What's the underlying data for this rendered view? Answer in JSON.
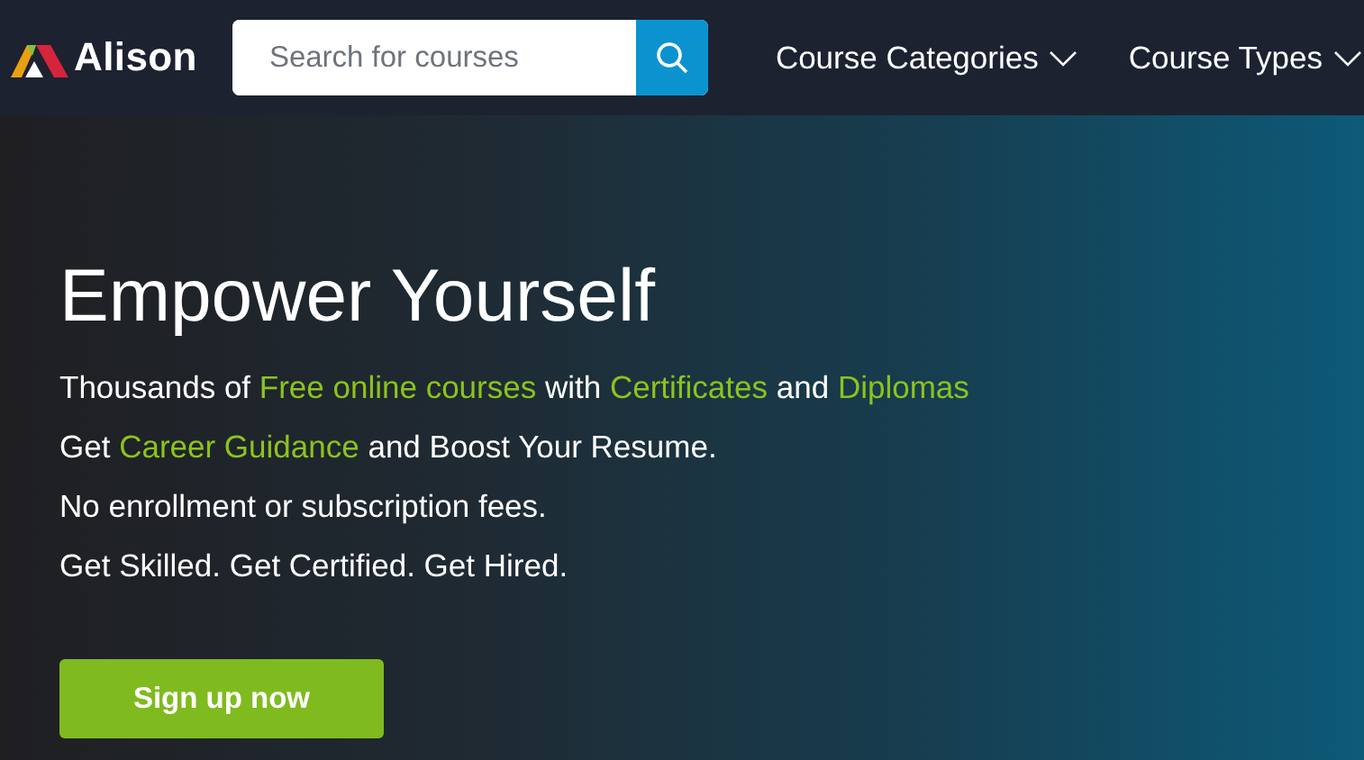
{
  "header": {
    "logo_text": "Alison",
    "search": {
      "placeholder": "Search for courses"
    },
    "nav": [
      {
        "label": "Course Categories"
      },
      {
        "label": "Course Types"
      }
    ]
  },
  "hero": {
    "title": "Empower Yourself",
    "lines": [
      [
        {
          "text": "Thousands of ",
          "kind": "plain"
        },
        {
          "text": "Free online courses",
          "kind": "link"
        },
        {
          "text": " with ",
          "kind": "plain"
        },
        {
          "text": "Certificates",
          "kind": "link"
        },
        {
          "text": " and ",
          "kind": "plain"
        },
        {
          "text": "Diplomas",
          "kind": "link"
        }
      ],
      [
        {
          "text": "Get ",
          "kind": "plain"
        },
        {
          "text": "Career Guidance",
          "kind": "link"
        },
        {
          "text": " and Boost Your Resume.",
          "kind": "plain"
        }
      ],
      [
        {
          "text": "No enrollment or subscription fees.",
          "kind": "plain"
        }
      ],
      [
        {
          "text": "Get Skilled. Get Certified. Get Hired.",
          "kind": "plain"
        }
      ]
    ],
    "button": "Sign up now"
  }
}
